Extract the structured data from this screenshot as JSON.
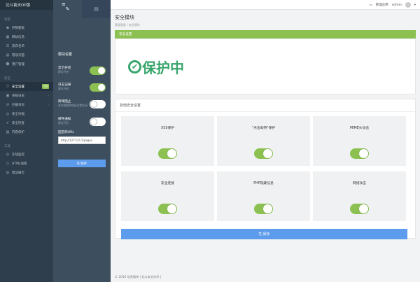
{
  "app": {
    "title": "北斗袁天OP版"
  },
  "sidebar": {
    "group1": "导航",
    "items1": [
      {
        "icon": "dashboard-icon",
        "glyph": "◉",
        "label": "控制面板"
      },
      {
        "icon": "sites-icon",
        "glyph": "▦",
        "label": "网站信息"
      },
      {
        "icon": "list-icon",
        "glyph": "☰",
        "label": "黑白名单"
      },
      {
        "icon": "doc-icon",
        "glyph": "▤",
        "label": "错误页面"
      },
      {
        "icon": "users-icon",
        "glyph": "☻",
        "label": "用户管理"
      }
    ],
    "group2": "安全",
    "items2": [
      {
        "icon": "shield-icon",
        "glyph": "⛉",
        "label": "安全设置",
        "badge": "ON",
        "active": true
      },
      {
        "icon": "log-icon",
        "glyph": "▣",
        "label": "系统日志",
        "chev": "‹"
      },
      {
        "icon": "block-icon",
        "glyph": "⊘",
        "label": "拦截日志",
        "chev": "‹"
      },
      {
        "icon": "scan-icon",
        "glyph": "◎",
        "label": "安全扫描"
      },
      {
        "icon": "check-icon",
        "glyph": "✔",
        "label": "安全检查"
      },
      {
        "icon": "protect-icon",
        "glyph": "▧",
        "label": "内容保护"
      }
    ],
    "group3": "工具",
    "items3": [
      {
        "icon": "monitor-icon",
        "glyph": "◴",
        "label": "在线监控"
      },
      {
        "icon": "html-icon",
        "glyph": "⟨⟩",
        "label": "HTML加密"
      },
      {
        "icon": "error-icon",
        "glyph": "◍",
        "label": "错误报告"
      }
    ]
  },
  "panel": {
    "tabs": [
      "✎",
      "▤"
    ],
    "title": "模块设置",
    "rows": [
      {
        "label": "显示开启",
        "sub": "建议开启",
        "state": "on"
      },
      {
        "label": "日志记录",
        "sub": "建议开启",
        "state": "on"
      },
      {
        "label": "跨域阻止",
        "sub": "有的需要跨域请设置关闭",
        "state": "off"
      },
      {
        "label": "邮件通知",
        "sub": "建议开启",
        "state": "off"
      }
    ],
    "url_label": "固定跨URL",
    "url_value": "http://127.0.0.1/pages",
    "save": "⎘ 保存"
  },
  "topbar": {
    "menu": "≡",
    "manage": "管理应用",
    "user": "admin",
    "caret": "▾"
  },
  "main": {
    "title": "安全模块",
    "breadcrumb": "管理面板  /  安全模块",
    "section1": "安全设置",
    "status": "保护中",
    "section2": "其他安全设置",
    "cards": [
      {
        "name": "XSS保护",
        "state": "on"
      },
      {
        "name": "\"点击劫持\"保护",
        "state": "on"
      },
      {
        "name": "MIME头攻击",
        "state": "on"
      },
      {
        "name": "安全连接",
        "state": "on"
      },
      {
        "name": "PHP隐藏信息",
        "state": "on"
      },
      {
        "name": "网络攻击",
        "state": "on"
      }
    ],
    "save": "⎘ 保存"
  },
  "footer": "© 2016 信息相关 | 北斗安全技术 |",
  "colors": {
    "sidebar": "#2f3e4c",
    "panel": "#3d4f5f",
    "green": "#8cc152",
    "blue": "#5d9cec",
    "status_green": "#37a46b"
  }
}
